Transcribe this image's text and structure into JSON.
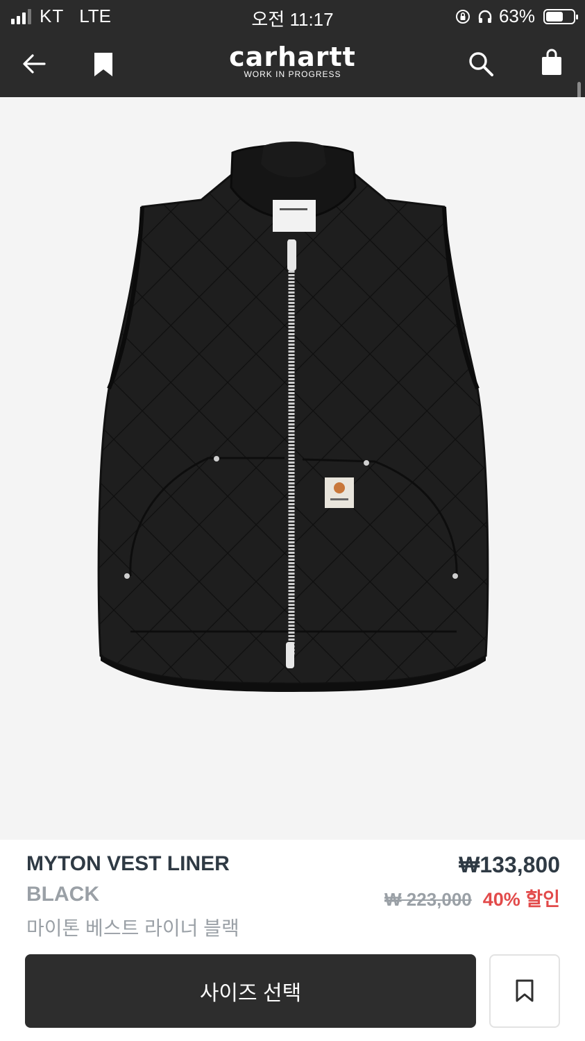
{
  "status_bar": {
    "carrier": "KT",
    "network": "LTE",
    "time": "오전 11:17",
    "battery_percent": "63%",
    "battery_level": 0.63
  },
  "header": {
    "logo_text": "carhartt",
    "logo_sub": "WORK IN PROGRESS",
    "colors": {
      "background": "#2b2b2b",
      "foreground": "#ffffff"
    }
  },
  "gallery": {
    "image_count": 8,
    "active_index": 3,
    "image_subject": "black quilted vest"
  },
  "product": {
    "name": "MYTON VEST LINER",
    "color": "BLACK",
    "korean_name": "마이톤 베스트 라이너 블랙",
    "price": "₩133,800",
    "original_price": "₩ 223,000",
    "discount": "40% 할인"
  },
  "actions": {
    "size_select_label": "사이즈 선택"
  },
  "colors": {
    "discount_red": "#e24a4a",
    "button_dark": "#2d2d2d",
    "muted_text": "#9aa0a6",
    "title_text": "#2f3a44"
  }
}
